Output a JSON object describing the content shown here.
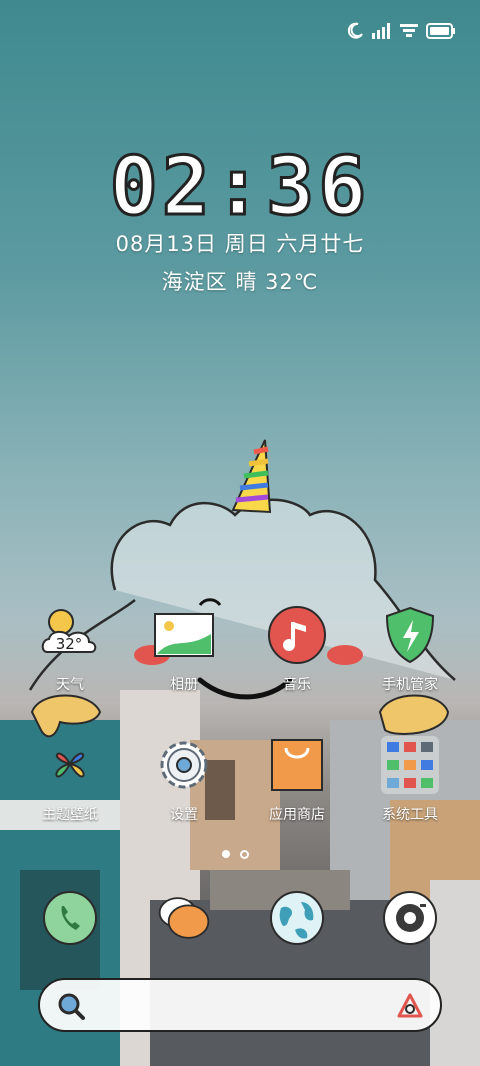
{
  "lockscreen": {
    "time": "02:36",
    "date": "08月13日 周日 六月廿七",
    "weather": "海淀区  晴  32℃"
  },
  "status_bar": {
    "icons": [
      "moon-icon",
      "signal-icon",
      "wifi-icon",
      "battery-icon"
    ]
  },
  "apps_row1": [
    {
      "label": "天气",
      "icon": "weather-icon",
      "temp": "32°"
    },
    {
      "label": "相册",
      "icon": "gallery-icon"
    },
    {
      "label": "音乐",
      "icon": "music-icon"
    },
    {
      "label": "手机管家",
      "icon": "security-icon"
    }
  ],
  "apps_row2": [
    {
      "label": "主题壁纸",
      "icon": "themes-icon"
    },
    {
      "label": "设置",
      "icon": "settings-icon"
    },
    {
      "label": "应用商店",
      "icon": "app-store-icon"
    },
    {
      "label": "系统工具",
      "icon": "system-tools-folder-icon"
    }
  ],
  "dock": [
    {
      "icon": "phone-icon"
    },
    {
      "icon": "messages-icon"
    },
    {
      "icon": "browser-icon"
    },
    {
      "icon": "camera-icon"
    }
  ],
  "page_indicator": {
    "current": 1,
    "total": 2
  },
  "colors": {
    "accent": "#e2554f",
    "outline": "#222222",
    "green": "#4fbf6c"
  }
}
